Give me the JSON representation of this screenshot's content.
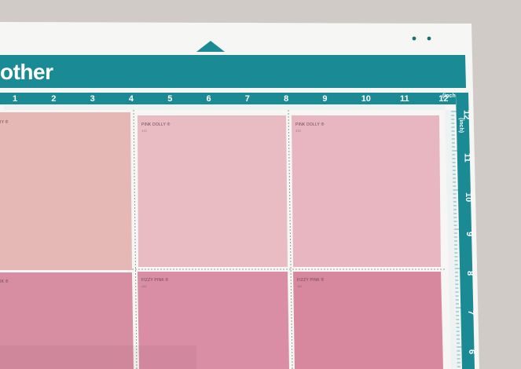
{
  "brand": {
    "logo_text": "other"
  },
  "mat": {
    "top_ruler_numbers": [
      "1",
      "2",
      "3",
      "4",
      "5",
      "6",
      "7",
      "8",
      "9",
      "10",
      "11",
      "12"
    ],
    "top_ruler_unit": "(inch)",
    "right_ruler_numbers": [
      "12",
      "11",
      "10",
      "9",
      "8",
      "7",
      "6"
    ],
    "right_ruler_unit": "(inch)",
    "colors": {
      "teal": "#1a8a94",
      "mat_white": "#f7f7f6",
      "left_swatch": "#e5b7b6",
      "pink_dolly": "#e8b8c2",
      "fizzy_pink": "#d98aa3"
    }
  },
  "swatches": [
    {
      "name": "PINK DOLLY ®",
      "code": "172"
    },
    {
      "name": "PINK DOLLY ®",
      "code": "172"
    },
    {
      "name": "FIZZY PINK ®",
      "code": "181"
    },
    {
      "name": "FIZZY PINK ®",
      "code": "181"
    }
  ],
  "partial_labels": {
    "top_left": "IY ®",
    "bottom_left": "IK ®"
  }
}
